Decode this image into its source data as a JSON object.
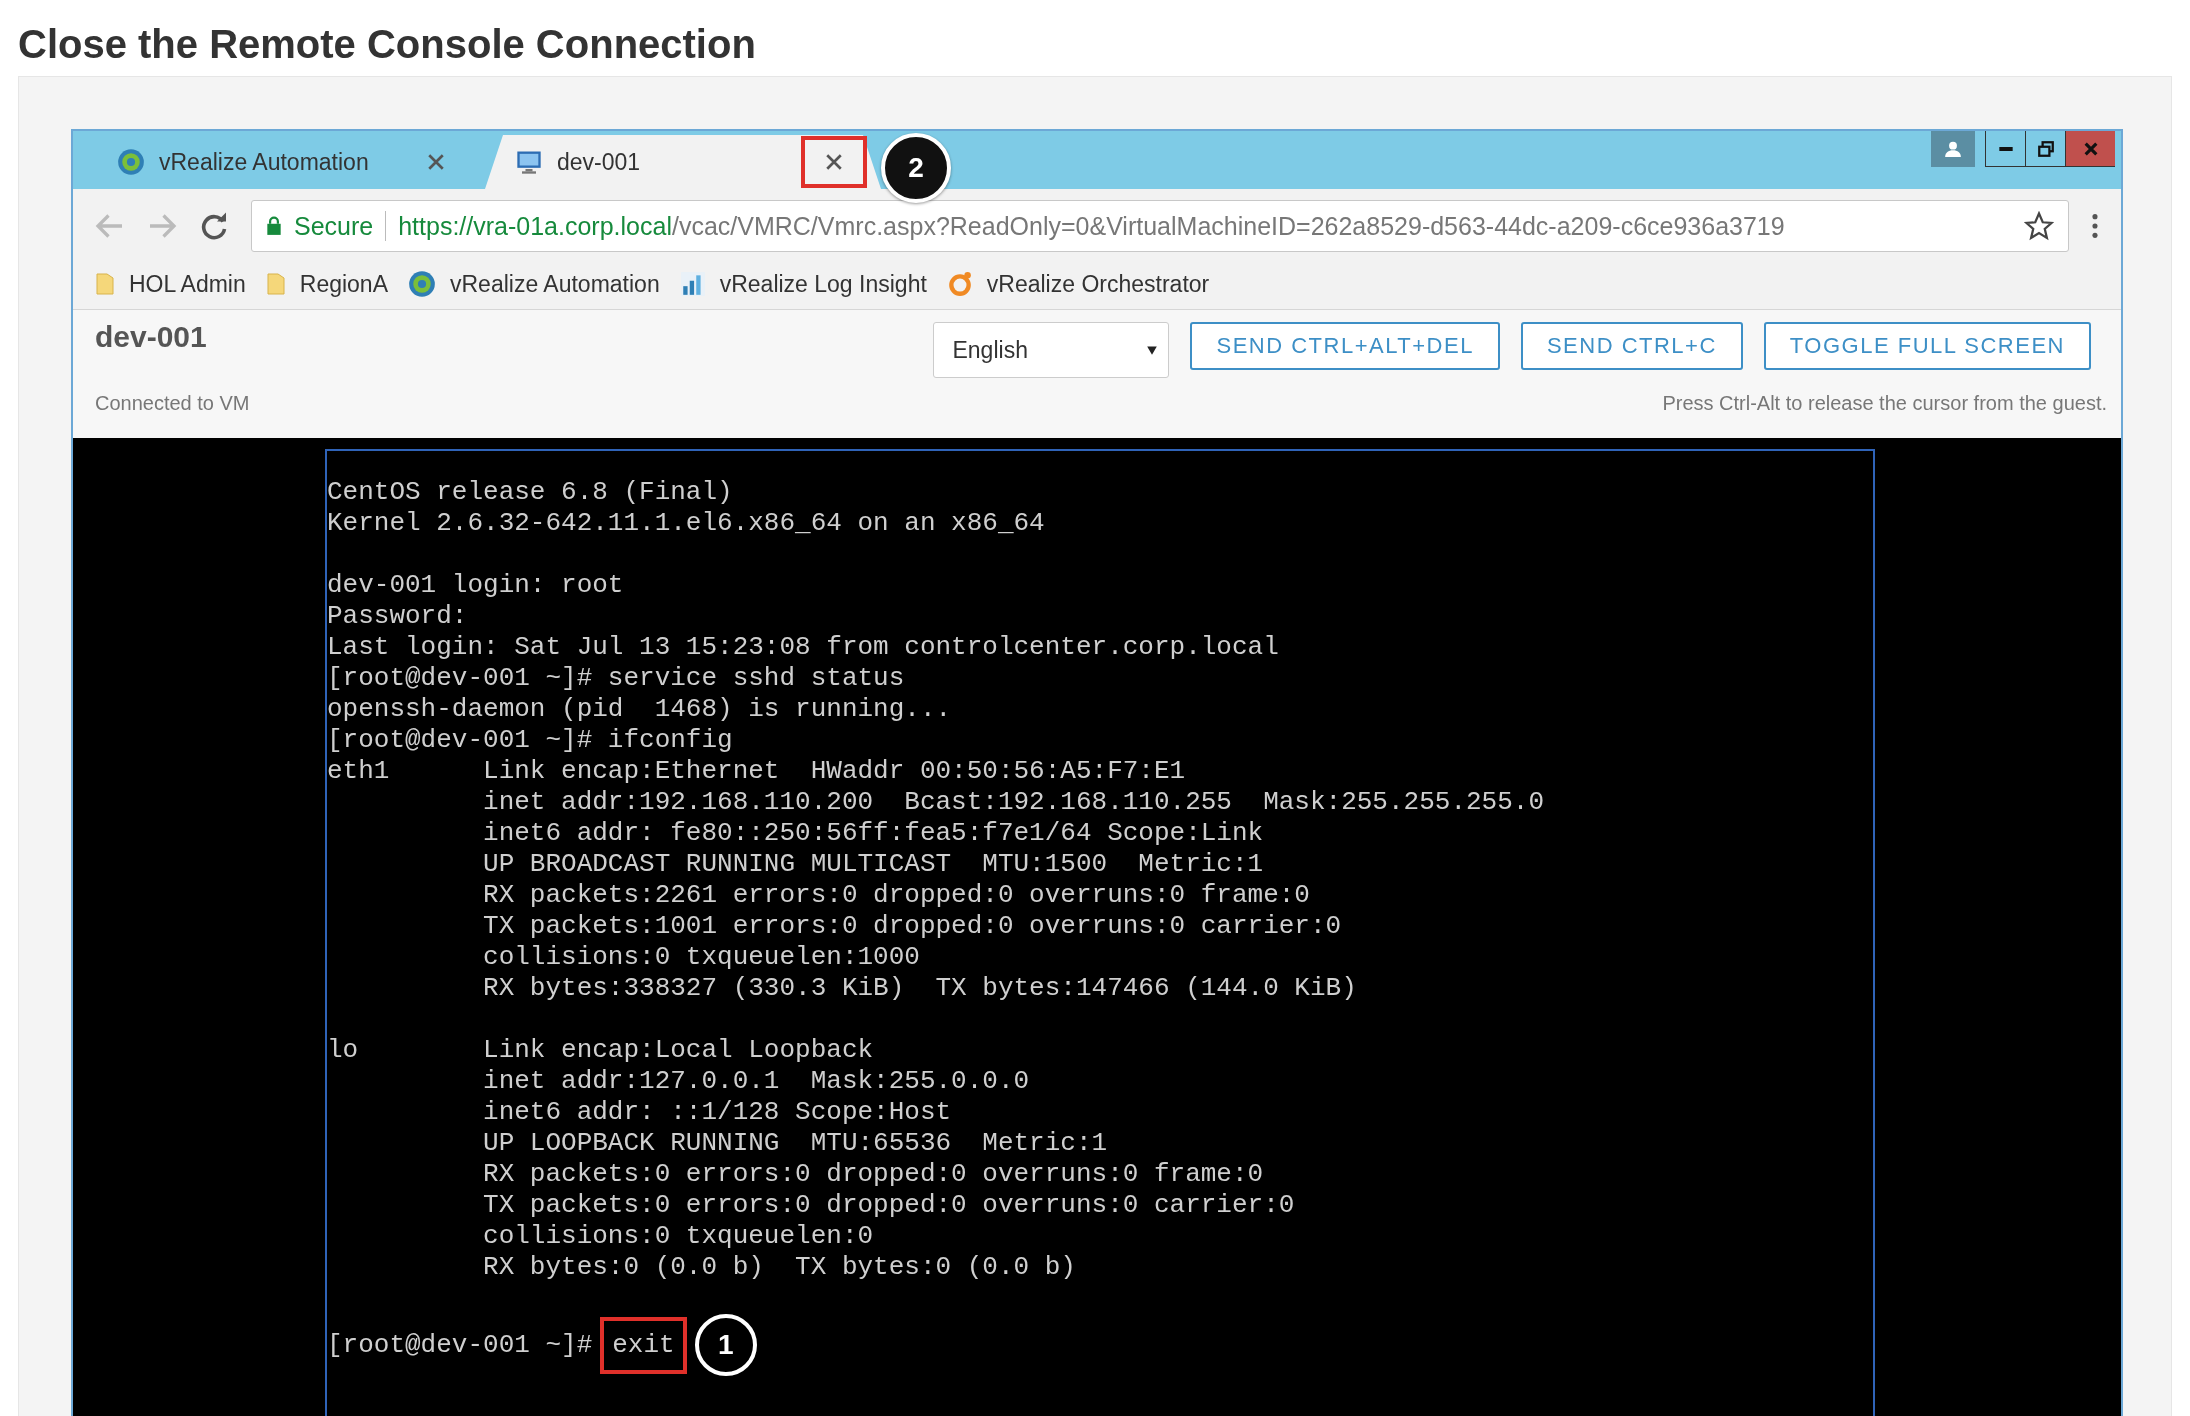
{
  "heading": "Close the Remote Console Connection",
  "browser": {
    "tabs": [
      {
        "label": "vRealize Automation",
        "kind": "vra",
        "selected": false,
        "highlighted": false
      },
      {
        "label": "dev-001",
        "kind": "monitor",
        "selected": true,
        "highlighted": true,
        "callout": "2"
      }
    ],
    "address": {
      "security": "Secure",
      "url_host": "https://vra-01a.corp.local",
      "url_path": "/vcac/VMRC/Vmrc.aspx?ReadOnly=0&VirtualMachineID=262a8529-d563-44dc-a209-c6ce936a3719"
    },
    "bookmarks": [
      {
        "label": "HOL Admin",
        "kind": "folder"
      },
      {
        "label": "RegionA",
        "kind": "folder"
      },
      {
        "label": "vRealize Automation",
        "kind": "vra"
      },
      {
        "label": "vRealize Log Insight",
        "kind": "chart"
      },
      {
        "label": "vRealize Orchestrator",
        "kind": "orchestrator"
      }
    ]
  },
  "console": {
    "title": "dev-001",
    "status": "Connected to VM",
    "hint": "Press Ctrl-Alt to release the cursor from the guest.",
    "language": "English",
    "buttons": [
      "SEND CTRL+ALT+DEL",
      "SEND CTRL+C",
      "TOGGLE FULL SCREEN"
    ]
  },
  "terminal": {
    "blocks": [
      [
        "CentOS release 6.8 (Final)",
        "Kernel 2.6.32-642.11.1.el6.x86_64 on an x86_64"
      ],
      [
        "dev-001 login: root",
        "Password:",
        "Last login: Sat Jul 13 15:23:08 from controlcenter.corp.local",
        "[root@dev-001 ~]# service sshd status",
        "openssh-daemon (pid  1468) is running...",
        "[root@dev-001 ~]# ifconfig",
        "eth1      Link encap:Ethernet  HWaddr 00:50:56:A5:F7:E1",
        "          inet addr:192.168.110.200  Bcast:192.168.110.255  Mask:255.255.255.0",
        "          inet6 addr: fe80::250:56ff:fea5:f7e1/64 Scope:Link",
        "          UP BROADCAST RUNNING MULTICAST  MTU:1500  Metric:1",
        "          RX packets:2261 errors:0 dropped:0 overruns:0 frame:0",
        "          TX packets:1001 errors:0 dropped:0 overruns:0 carrier:0",
        "          collisions:0 txqueuelen:1000",
        "          RX bytes:338327 (330.3 KiB)  TX bytes:147466 (144.0 KiB)"
      ],
      [
        "lo        Link encap:Local Loopback",
        "          inet addr:127.0.0.1  Mask:255.0.0.0",
        "          inet6 addr: ::1/128 Scope:Host",
        "          UP LOOPBACK RUNNING  MTU:65536  Metric:1",
        "          RX packets:0 errors:0 dropped:0 overruns:0 frame:0",
        "          TX packets:0 errors:0 dropped:0 overruns:0 carrier:0",
        "          collisions:0 txqueuelen:0",
        "          RX bytes:0 (0.0 b)  TX bytes:0 (0.0 b)"
      ]
    ],
    "prompt": "[root@dev-001 ~]#",
    "command": "exit",
    "command_highlighted": true,
    "callout": "1"
  }
}
